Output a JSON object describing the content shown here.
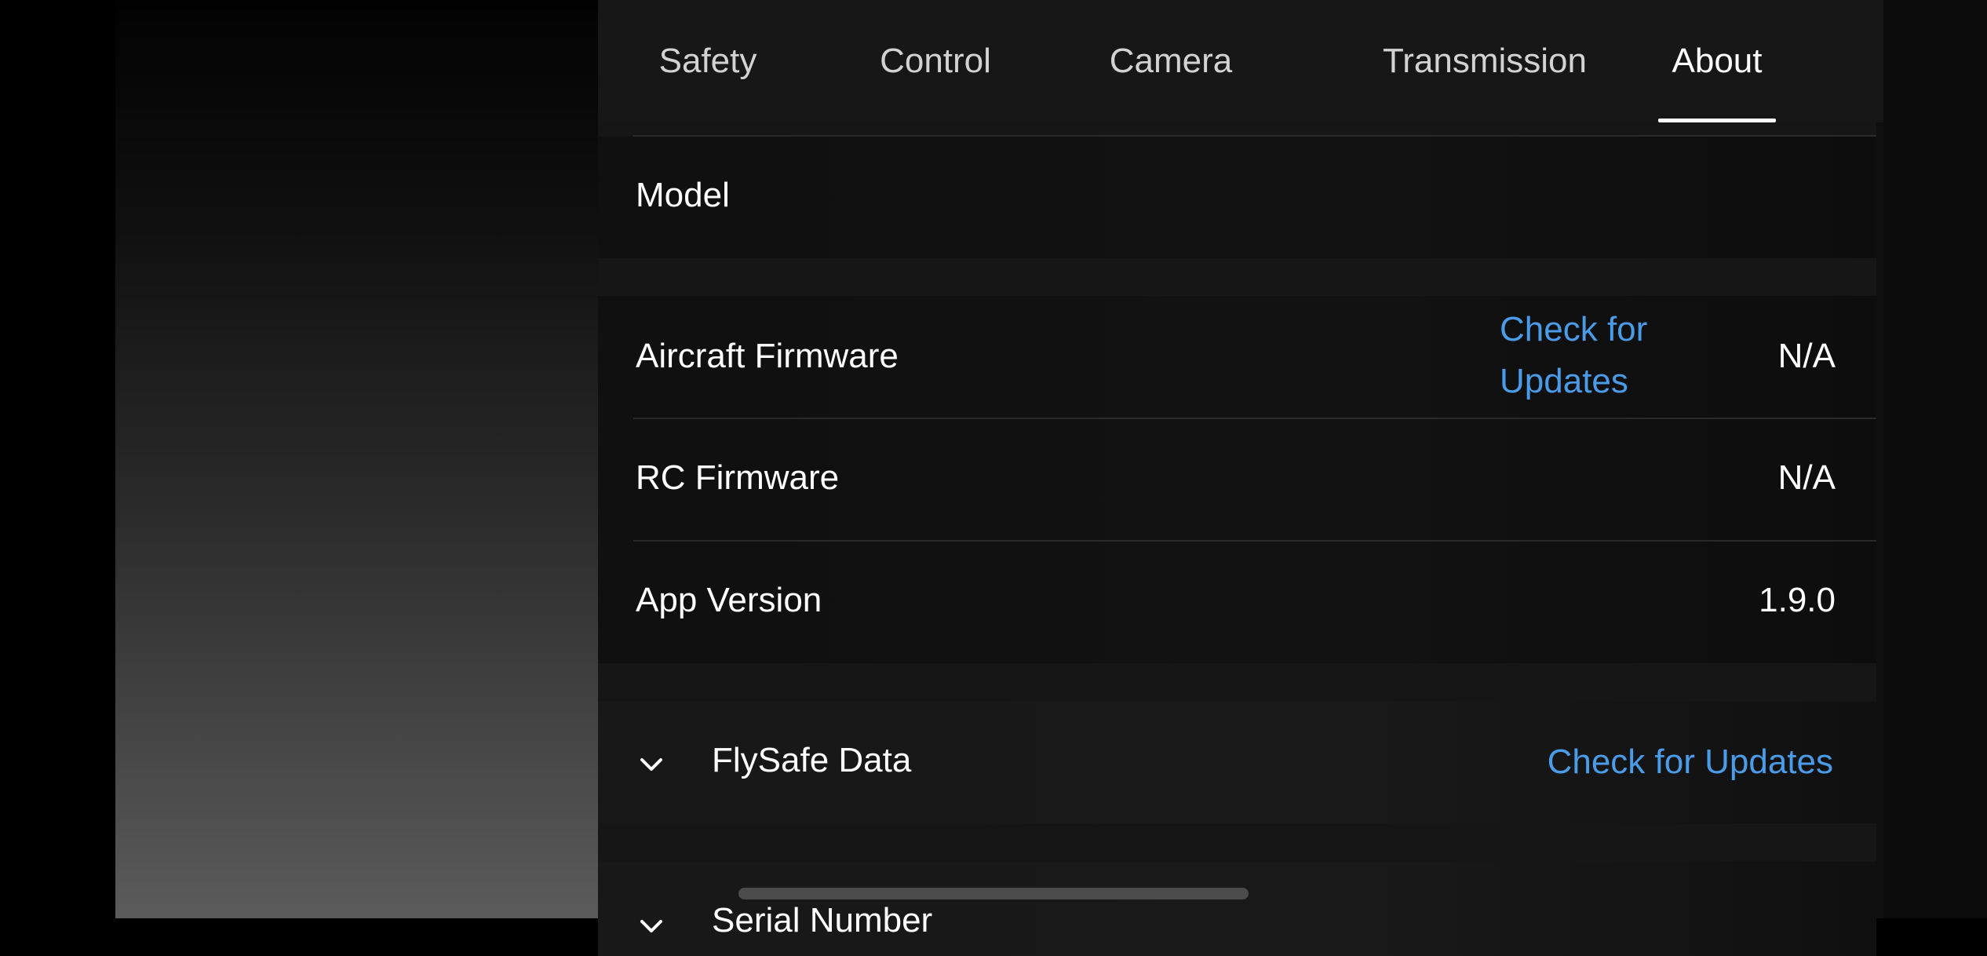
{
  "tabs": [
    {
      "label": "Safety",
      "active": false
    },
    {
      "label": "Control",
      "active": false
    },
    {
      "label": "Camera",
      "active": false
    },
    {
      "label": "Transmission",
      "active": false
    },
    {
      "label": "About",
      "active": true
    }
  ],
  "about": {
    "model": {
      "label": "Model",
      "value": ""
    },
    "aircraft_firmware": {
      "label": "Aircraft Firmware",
      "action": "Check for Updates",
      "action_line1": "Check for",
      "action_line2": "Updates",
      "value": "N/A"
    },
    "rc_firmware": {
      "label": "RC Firmware",
      "value": "N/A"
    },
    "app_version": {
      "label": "App Version",
      "value": "1.9.0"
    },
    "flysafe": {
      "label": "FlySafe Data",
      "action": "Check for Updates",
      "icon": "chevron-down-icon"
    },
    "serial_number": {
      "label": "Serial Number",
      "icon": "chevron-down-icon"
    }
  },
  "colors": {
    "accent_link": "#4a9be8",
    "panel_bg": "#161616",
    "text": "#ffffff",
    "tab_inactive": "#d2d2d2"
  }
}
